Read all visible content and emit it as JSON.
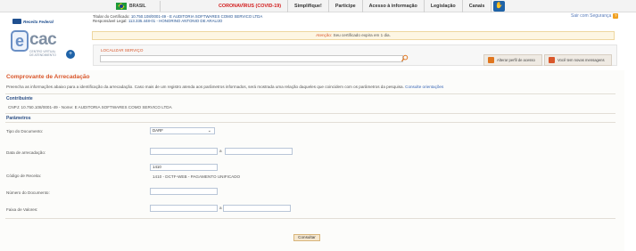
{
  "govbar": {
    "country": "BRASIL",
    "links": [
      "CORONAVÍRUS (COVID-19)",
      "Simplifique!",
      "Participe",
      "Acesso à informação",
      "Legislação",
      "Canais"
    ]
  },
  "header": {
    "agency": "Receita Federal",
    "app_name_e": "e",
    "app_name": "cac",
    "app_subtitle_1": "CENTRO VIRTUAL",
    "app_subtitle_2": "DE ATENDIMENTO",
    "cert_holder_label": "Titular do Certificado:",
    "cert_holder": "10.750.108/0001-49 - E AUDITORIA SOFTWARES COMO SERVICO LTDA",
    "legal_rep_label": "Responsável Legal:",
    "legal_rep": "113.335.448-01 - HONORINO ANTONIO DE ARAUJO",
    "security_link": "Sair com Segurança",
    "alert_attention": "Atenção:",
    "alert_text": "Seu certificado expira em 1 dia."
  },
  "search": {
    "label": "LOCALIZAR SERVIÇO",
    "placeholder": "",
    "alter_profile": "Alterar perfil de acesso",
    "messages": "Você tem novas mensagens"
  },
  "page": {
    "title": "Comprovante de Arrecadação",
    "intro": "Preencha as informações abaixo para a identificação da arrecadação. Caso mais de um registro atenda aos parâmetros informados, será mostrada uma relação daqueles que coincidem com os parâmetros da pesquisa.",
    "intro_link": "Consulte orientações",
    "contribuinte_heading": "Contribuinte",
    "contribuinte_line": "CNPJ: 10.750.108/0001-49 - Nome: E AUDITORIA SOFTWARES COMO SERVICO LTDA",
    "parametros_heading": "Parâmetros"
  },
  "form": {
    "tipo_label": "Tipo do Documento:",
    "tipo_value": "DARF",
    "data_label": "Data de arrecadação:",
    "data_from": "",
    "data_to": "",
    "range_sep": "a",
    "codigo_label": "Código de Receita:",
    "codigo_value": "1410",
    "codigo_desc": "1410 - DCTF-WEB - PAGAMENTO UNIFICADO",
    "numero_label": "Número do Documento:",
    "numero_value": "",
    "faixa_label": "Faixa de Valores:",
    "faixa_from": "",
    "faixa_to": "",
    "submit": "Consultar"
  },
  "colors": {
    "accent": "#d9572b",
    "brand_blue": "#1f63a8",
    "covid": "#d21c1c"
  }
}
